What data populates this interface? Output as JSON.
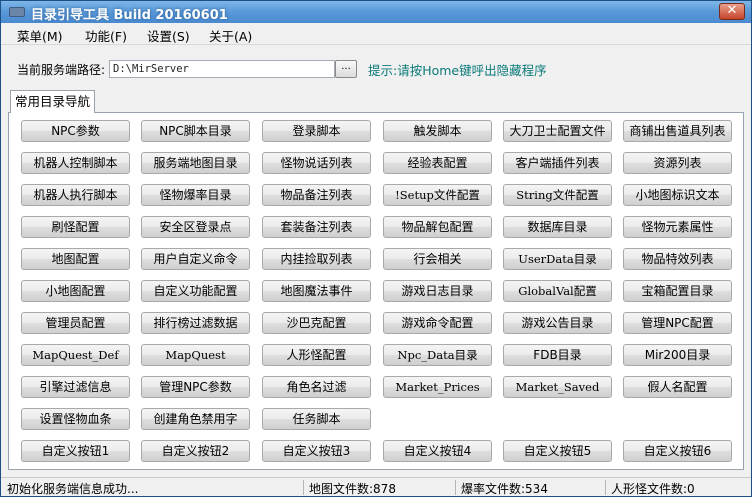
{
  "window": {
    "title": "目录引导工具 Build 20160601",
    "close_label": "✕"
  },
  "menu": {
    "items": [
      "菜单(M)",
      "功能(F)",
      "设置(S)",
      "关于(A)"
    ]
  },
  "path": {
    "label": "当前服务端路径:",
    "value": "D:\\MirServer",
    "browse_label": "...",
    "hint": "提示:请按Home键呼出隐藏程序"
  },
  "tab": {
    "label": "常用目录导航"
  },
  "buttons": [
    [
      "NPC参数",
      "NPC脚本目录",
      "登录脚本",
      "触发脚本",
      "大刀卫士配置文件",
      "商铺出售道具列表"
    ],
    [
      "机器人控制脚本",
      "服务端地图目录",
      "怪物说话列表",
      "经验表配置",
      "客户端插件列表",
      "资源列表"
    ],
    [
      "机器人执行脚本",
      "怪物爆率目录",
      "物品备注列表",
      "!Setup文件配置",
      "String文件配置",
      "小地图标识文本"
    ],
    [
      "刷怪配置",
      "安全区登录点",
      "套装备注列表",
      "物品解包配置",
      "数据库目录",
      "怪物元素属性"
    ],
    [
      "地图配置",
      "用户自定义命令",
      "内挂捡取列表",
      "行会相关",
      "UserData目录",
      "物品特效列表"
    ],
    [
      "小地图配置",
      "自定义功能配置",
      "地图魔法事件",
      "游戏日志目录",
      "GlobalVal配置",
      "宝箱配置目录"
    ],
    [
      "管理员配置",
      "排行榜过滤数据",
      "沙巴克配置",
      "游戏命令配置",
      "游戏公告目录",
      "管理NPC配置"
    ],
    [
      "MapQuest_Def",
      "MapQuest",
      "人形怪配置",
      "Npc_Data目录",
      "FDB目录",
      "Mir200目录"
    ],
    [
      "引擎过滤信息",
      "管理NPC参数",
      "角色名过滤",
      "Market_Prices",
      "Market_Saved",
      "假人名配置"
    ],
    [
      "设置怪物血条",
      "创建角色禁用字",
      "任务脚本"
    ],
    [
      "自定义按钮1",
      "自定义按钮2",
      "自定义按钮3",
      "自定义按钮4",
      "自定义按钮5",
      "自定义按钮6"
    ]
  ],
  "status": {
    "message": "初始化服务端信息成功...",
    "map_count": "地图文件数:878",
    "drop_count": "爆率文件数:534",
    "humanoid_count": "人形怪文件数:0"
  }
}
